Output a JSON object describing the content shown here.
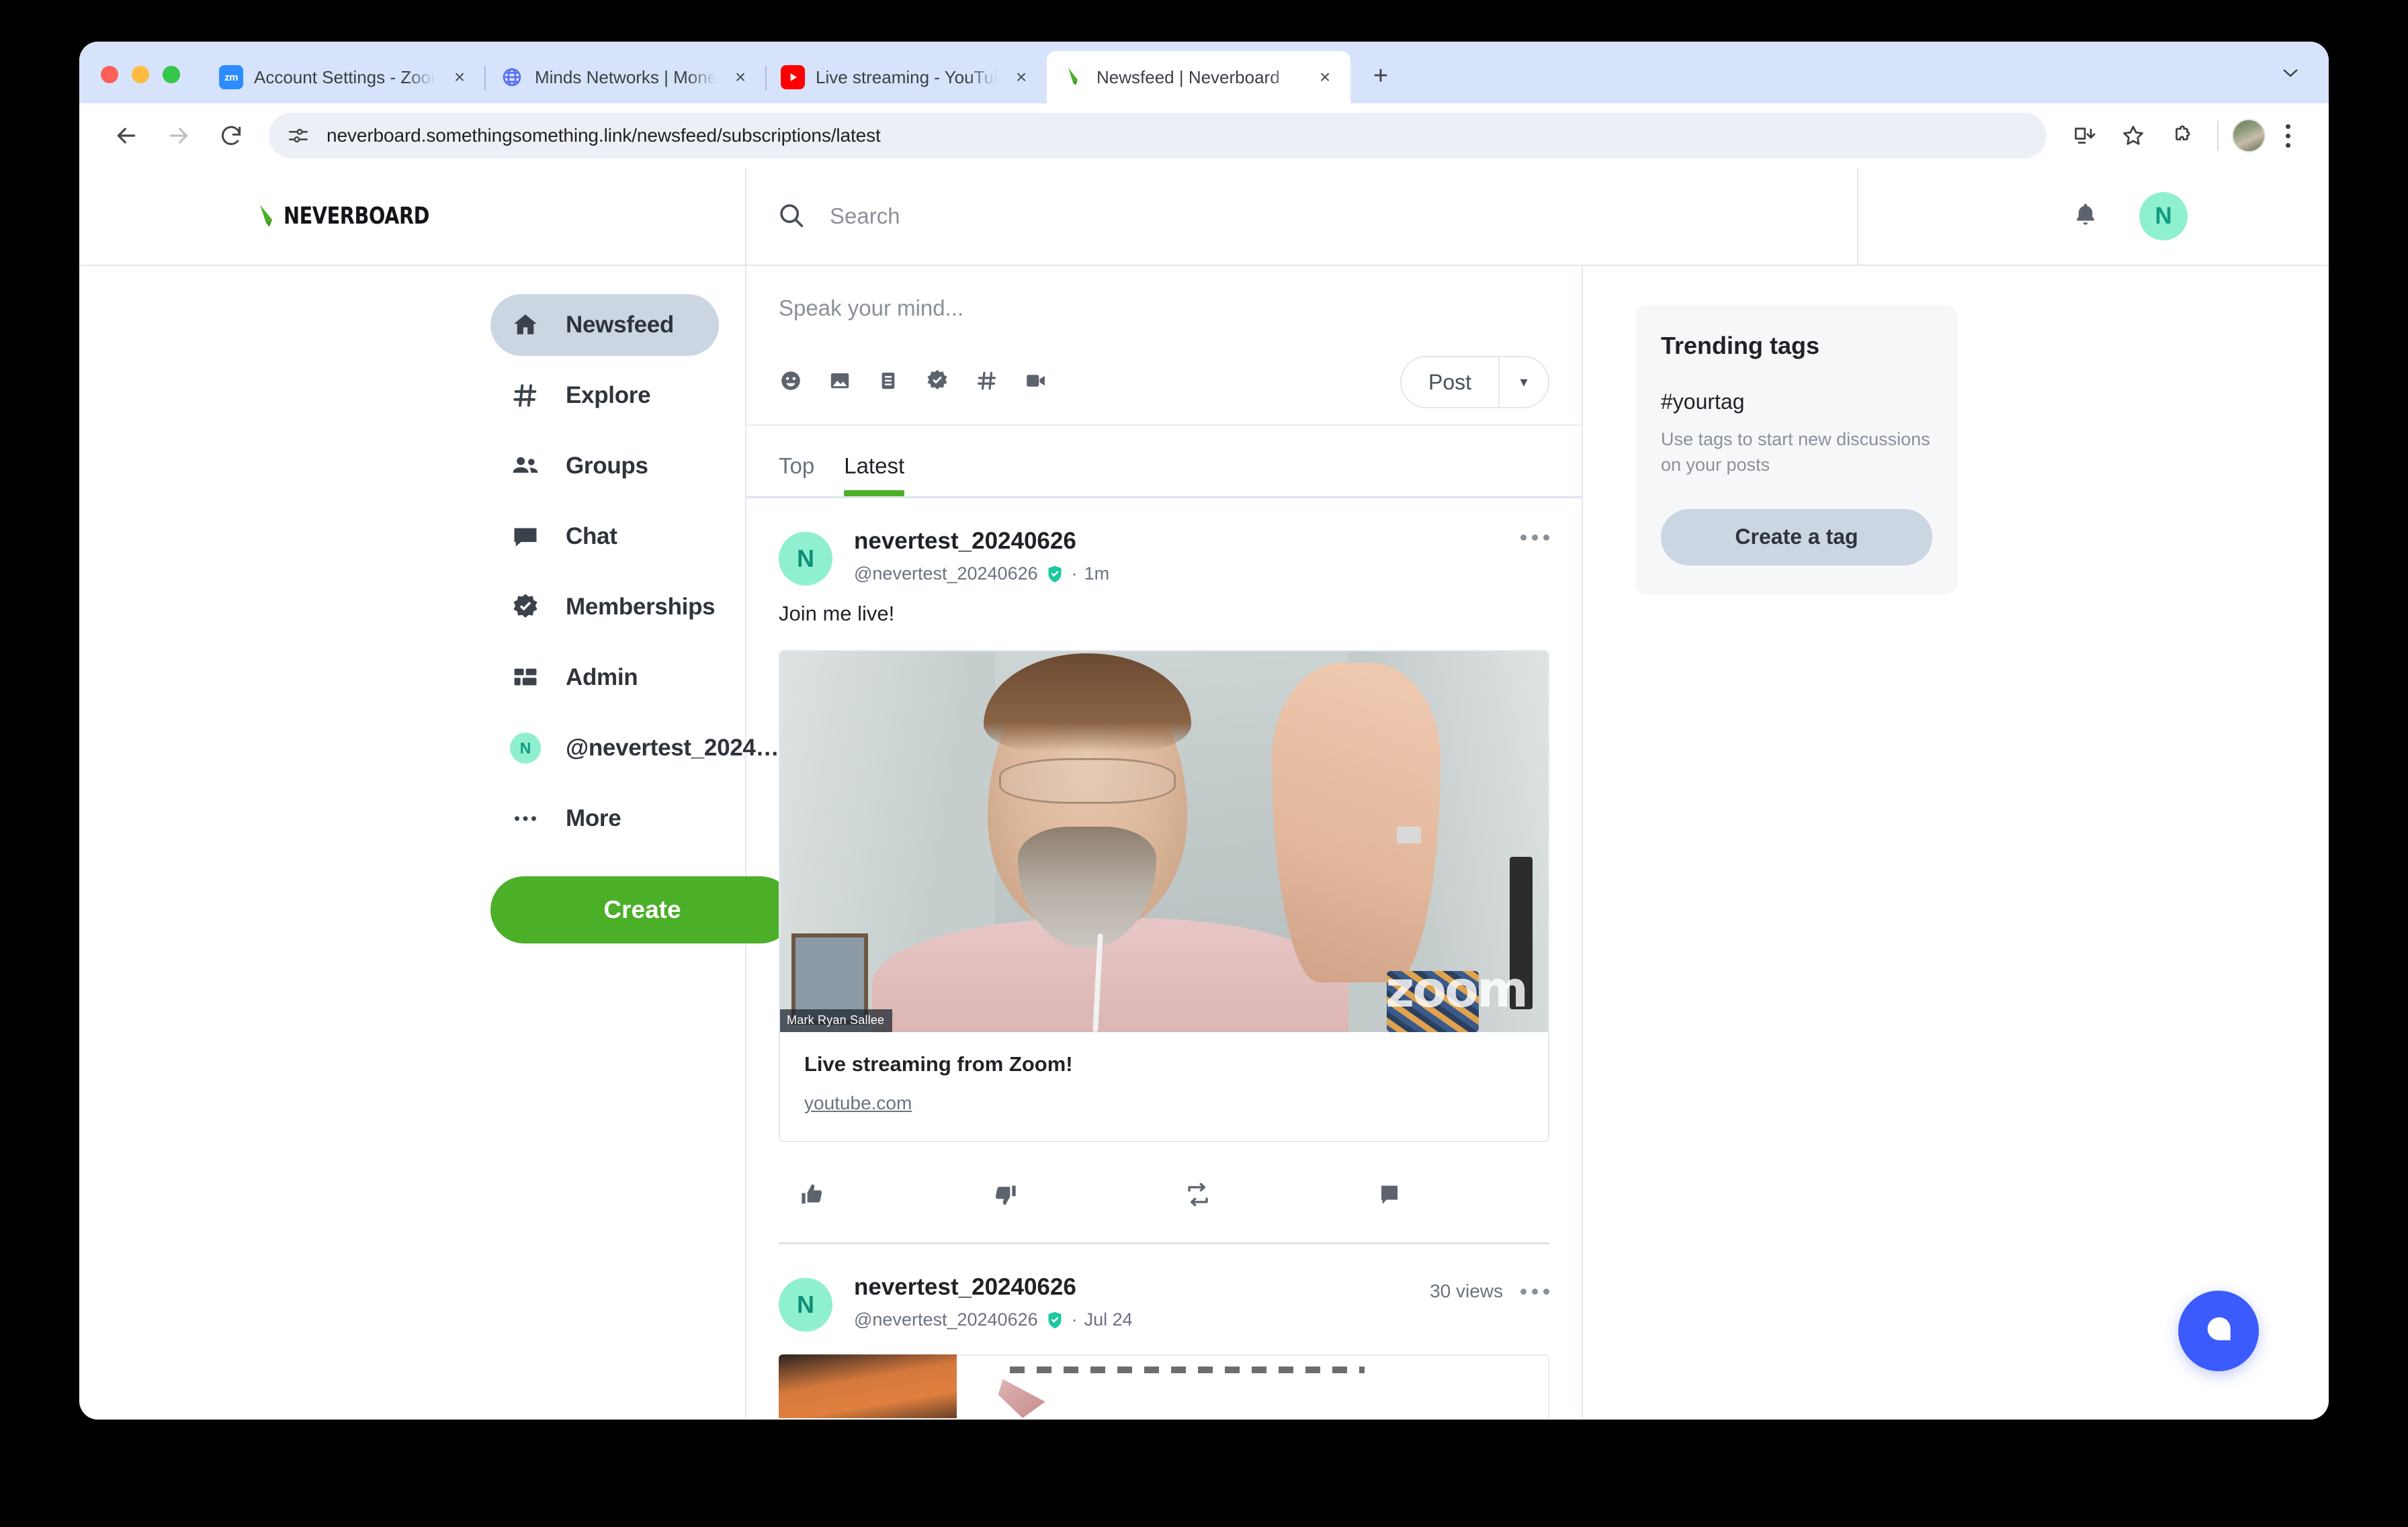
{
  "browser": {
    "tabs": [
      {
        "title": "Account Settings - Zoom",
        "favicon": "zoom-favicon",
        "active": false
      },
      {
        "title": "Minds Networks | Monetize a...",
        "favicon": "globe-favicon",
        "active": false
      },
      {
        "title": "Live streaming - YouTube Stu...",
        "favicon": "youtube-favicon",
        "active": false
      },
      {
        "title": "Newsfeed | Neverboard",
        "favicon": "neverboard-favicon",
        "active": true
      }
    ],
    "new_tab_label": "+",
    "close_label": "×",
    "tab_list_chevron": "⌄",
    "url": "neverboard.somethingsomething.link/newsfeed/subscriptions/latest",
    "nav": {
      "back": "←",
      "forward": "→",
      "reload": "⟳"
    }
  },
  "header": {
    "logo_text": "NEVERBOARD",
    "search_placeholder": "Search",
    "avatar_initial": "N"
  },
  "sidebar": {
    "items": [
      {
        "label": "Newsfeed",
        "icon": "home-icon",
        "active": true
      },
      {
        "label": "Explore",
        "icon": "hashtag-icon",
        "active": false
      },
      {
        "label": "Groups",
        "icon": "groups-icon",
        "active": false
      },
      {
        "label": "Chat",
        "icon": "chat-icon",
        "active": false
      },
      {
        "label": "Memberships",
        "icon": "verified-badge-icon",
        "active": false
      },
      {
        "label": "Admin",
        "icon": "dashboard-icon",
        "active": false
      },
      {
        "label": "@nevertest_2024…",
        "icon": "user-avatar-icon",
        "active": false
      },
      {
        "label": "More",
        "icon": "more-horizontal-icon",
        "active": false
      }
    ],
    "avatar_initial": "N",
    "create_label": "Create"
  },
  "composer": {
    "placeholder": "Speak your mind...",
    "tools": [
      "emoji-icon",
      "image-icon",
      "embed-icon",
      "verified-badge-icon",
      "hashtag-icon",
      "video-camera-icon"
    ],
    "post_label": "Post",
    "post_caret": "▾"
  },
  "feed": {
    "tabs": [
      {
        "label": "Top",
        "active": false
      },
      {
        "label": "Latest",
        "active": true
      }
    ],
    "posts": [
      {
        "avatar_initial": "N",
        "display_name": "nevertest_20240626",
        "handle": "@nevertest_20240626",
        "separator": "·",
        "timestamp": "1m",
        "views": "",
        "text": "Join me live!",
        "embed": {
          "speaker_name": "Mark Ryan Sallee",
          "watermark": "zoom",
          "title": "Live streaming from Zoom!",
          "domain": "youtube.com"
        },
        "actions": [
          "thumbs-up-icon",
          "thumbs-down-icon",
          "remind-icon",
          "comment-icon"
        ]
      },
      {
        "avatar_initial": "N",
        "display_name": "nevertest_20240626",
        "handle": "@nevertest_20240626",
        "separator": "·",
        "timestamp": "Jul 24",
        "views": "30 views",
        "text": "",
        "embed": null,
        "actions": []
      }
    ]
  },
  "rail": {
    "trending_title": "Trending tags",
    "tag_name": "#yourtag",
    "tag_description": "Use tags to start new discussions on your posts",
    "create_tag_label": "Create a tag"
  },
  "colors": {
    "brand_green": "#4caf28",
    "accent_mint": "#8ff0cf",
    "verified_teal": "#1cc9a0",
    "fab_blue": "#3b5bfd",
    "nav_active_bg": "#ccd6e2"
  }
}
